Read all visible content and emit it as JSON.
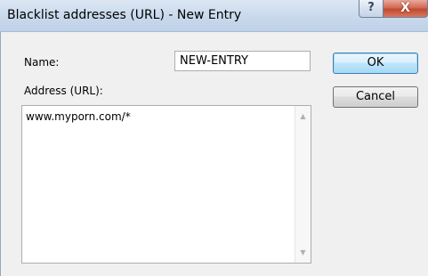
{
  "window": {
    "title": "Blacklist addresses (URL) - New Entry",
    "help_glyph": "?",
    "close_glyph": "X"
  },
  "form": {
    "name_label": "Name:",
    "name_value": "NEW-ENTRY",
    "address_label": "Address (URL):",
    "address_value": "www.myporn.com/*",
    "scroll_up_glyph": "▲",
    "scroll_down_glyph": "▼"
  },
  "buttons": {
    "ok_label": "OK",
    "cancel_label": "Cancel"
  },
  "icons": {
    "help": "help-icon",
    "close": "close-icon",
    "scroll_up": "chevron-up-icon",
    "scroll_down": "chevron-down-icon"
  }
}
